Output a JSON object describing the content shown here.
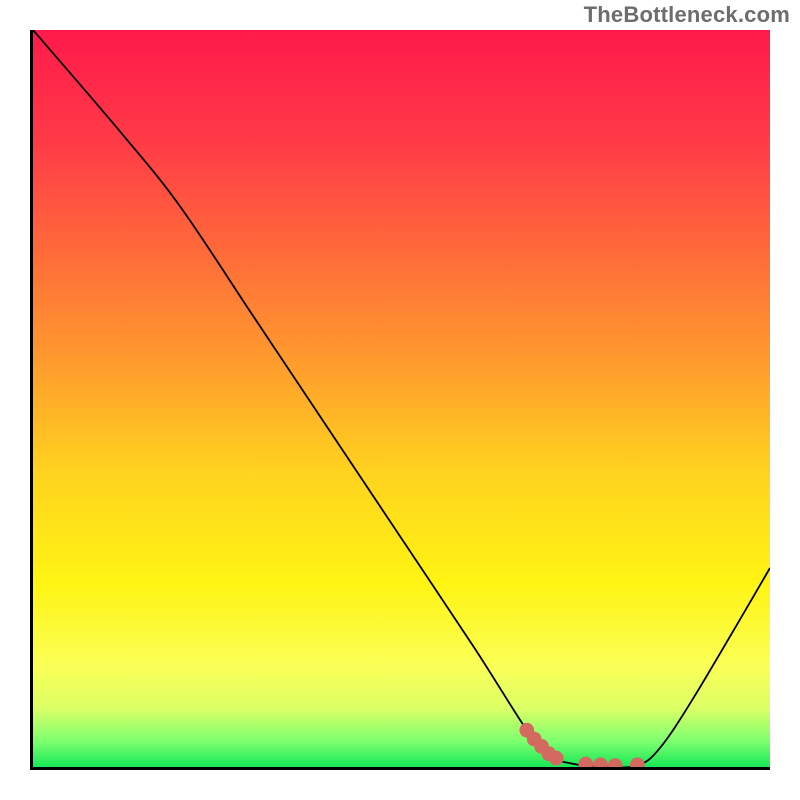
{
  "attribution": "TheBottleneck.com",
  "chart_data": {
    "type": "line",
    "title": "",
    "xlabel": "",
    "ylabel": "",
    "xlim": [
      0,
      100
    ],
    "ylim": [
      0,
      100
    ],
    "grid": false,
    "legend": false,
    "annotations": [],
    "background_gradient_stops": [
      {
        "offset": 0.0,
        "color": "#ff1a4b"
      },
      {
        "offset": 0.15,
        "color": "#ff3a47"
      },
      {
        "offset": 0.3,
        "color": "#ff6a3a"
      },
      {
        "offset": 0.45,
        "color": "#ff9b2d"
      },
      {
        "offset": 0.6,
        "color": "#ffd31f"
      },
      {
        "offset": 0.75,
        "color": "#fff413"
      },
      {
        "offset": 0.86,
        "color": "#fbff55"
      },
      {
        "offset": 0.92,
        "color": "#dcff66"
      },
      {
        "offset": 0.965,
        "color": "#7dff6f"
      },
      {
        "offset": 1.0,
        "color": "#17e858"
      }
    ],
    "series": [
      {
        "name": "bottleneck-curve",
        "color": "#000000",
        "stroke_width": 1.8,
        "x": [
          0,
          12,
          20,
          30,
          40,
          50,
          60,
          67,
          70,
          74,
          78,
          82,
          85,
          90,
          100
        ],
        "values": [
          100,
          86,
          76,
          61,
          46,
          31,
          16,
          5,
          1.5,
          0.3,
          0.0,
          0.2,
          2.5,
          10,
          27
        ]
      },
      {
        "name": "optimal-band-markers",
        "color": "#d46a5f",
        "type": "scatter",
        "marker_size": 10,
        "x": [
          67,
          68,
          69,
          70,
          71,
          75,
          77,
          79,
          82
        ],
        "values": [
          5.0,
          3.8,
          2.8,
          1.8,
          1.2,
          0.4,
          0.3,
          0.2,
          0.3
        ]
      }
    ]
  }
}
